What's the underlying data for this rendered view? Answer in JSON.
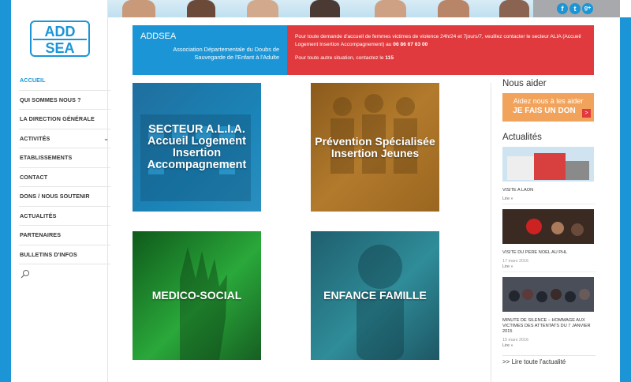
{
  "brand": {
    "logo_text": "ADD SEA",
    "colors": {
      "primary": "#1b95d6",
      "alert": "#e03a3e",
      "donate": "#f2a35b"
    }
  },
  "nav": {
    "items": [
      {
        "label": "ACCUEIL",
        "active": true
      },
      {
        "label": "QUI SOMMES NOUS ?"
      },
      {
        "label": "LA DIRECTION GÉNÉRALE"
      },
      {
        "label": "ACTIVITÉS",
        "has_submenu": true
      },
      {
        "label": "ETABLISSEMENTS"
      },
      {
        "label": "CONTACT"
      },
      {
        "label": "DONS / NOUS SOUTENIR"
      },
      {
        "label": "ACTUALITÉS"
      },
      {
        "label": "PARTENAIRES"
      },
      {
        "label": "BULLETINS D'INFOS"
      }
    ],
    "search_icon": "search-icon"
  },
  "social": {
    "items": [
      "f",
      "t",
      "g+"
    ]
  },
  "intro": {
    "title": "ADDSEA",
    "subtitle": "Association Départementale du Doubs de Sauvegarde de l'Enfant à l'Adulte"
  },
  "alert": {
    "line1": "Pour toute demande d'accueil de femmes victimes de violence 24h/24 et 7jours/7, veuillez contacter le secteur ALIA (Accueil Logement Insertion Accompagnement) au",
    "phone": "06 86 67 63 00",
    "line2": "Pour toute autre situation, contactez le",
    "number": "115"
  },
  "tiles": [
    {
      "label": "SECTEUR A.L.I.A. Accueil Logement Insertion Accompagnement"
    },
    {
      "label": "Prévention Spécialisée Insertion Jeunes"
    },
    {
      "label": "MEDICO-SOCIAL"
    },
    {
      "label": "ENFANCE FAMILLE"
    }
  ],
  "aside": {
    "help_title": "Nous aider",
    "donate": {
      "line1": "Aidez nous à les aider",
      "line2": "JE FAIS UN DON",
      "arrow": ">"
    },
    "news_title": "Actualités",
    "news": [
      {
        "title": "VISITE A LAON",
        "date": "",
        "more": "Lire »"
      },
      {
        "title": "VISITE DU PERE NOEL AU PHL",
        "date": "17 mars 2016",
        "more": "Lire »"
      },
      {
        "title": "MINUTE DE SILENCE – HOMMAGE AUX VICTIMES DES ATTENTATS DU 7 JANVIER 2015",
        "date": "15 mars 2016",
        "more": "Lire »"
      }
    ],
    "all_news": ">> Lire toute l'actualité"
  }
}
